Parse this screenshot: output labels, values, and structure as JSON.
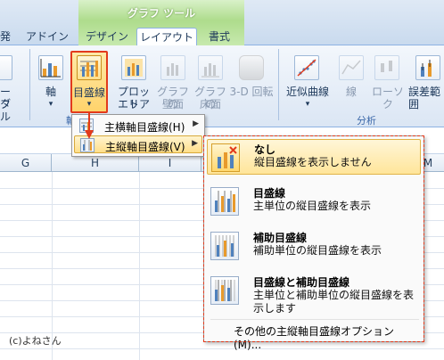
{
  "ribbon": {
    "context_label": "グラフ ツール",
    "tabs": [
      "発",
      "アドイン",
      "デザイン",
      "レイアウト",
      "書式"
    ],
    "groups": {
      "axes_label": "軸",
      "analysis_label": "分析"
    },
    "buttons": {
      "data_table_line1": "ータ",
      "data_table_line2": "ブル",
      "axes": "軸",
      "gridlines": "目盛線",
      "plot_area_line1": "プロット",
      "plot_area_line2": "エリア",
      "chart_wall_line1": "グラフの",
      "chart_wall_line2": "壁面",
      "chart_floor_line1": "グラフの",
      "chart_floor_line2": "床面",
      "rotation_3d": "3-D 回転",
      "trendline": "近似曲線",
      "lines": "線",
      "up_down_bars": "ローソク",
      "error_bars": "誤差範囲"
    }
  },
  "sheet": {
    "columns": [
      "G",
      "H",
      "I",
      "M"
    ],
    "credit": "(c)よねさん"
  },
  "menu1": {
    "items": [
      {
        "label": "主横軸目盛線(H)"
      },
      {
        "label": "主縦軸目盛線(V)"
      }
    ]
  },
  "menu2": {
    "items": [
      {
        "title": "なし",
        "desc": "縦目盛線を表示しません"
      },
      {
        "title": "目盛線",
        "desc": "主単位の縦目盛線を表示"
      },
      {
        "title": "補助目盛線",
        "desc": "補助単位の縦目盛線を表示"
      },
      {
        "title": "目盛線と補助目盛線",
        "desc": "主単位と補助単位の縦目盛線を表示します"
      }
    ],
    "more_options": "その他の主縦軸目盛線オプション(M)..."
  },
  "colors": {
    "accent_highlight": "#ffd36b",
    "selection_outline": "#e23a1c",
    "context_tab_green": "#aedc8c"
  }
}
